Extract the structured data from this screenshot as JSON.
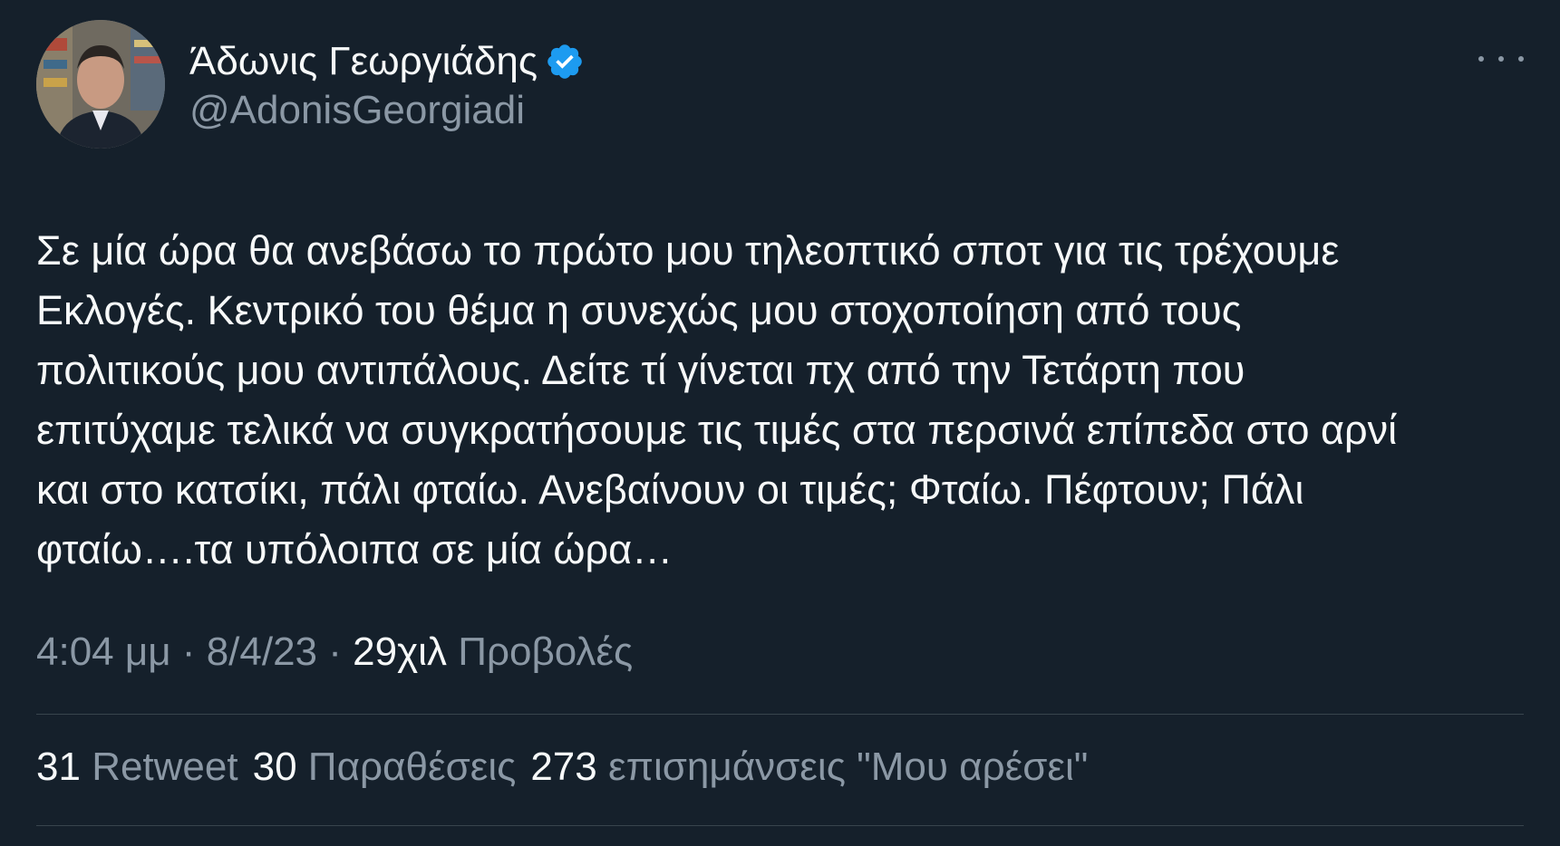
{
  "author": {
    "display_name": "Άδωνις Γεωργιάδης",
    "handle": "@AdonisGeorgiadi",
    "verified_icon": "verified-badge-icon",
    "avatar_icon": "profile-photo"
  },
  "menu": {
    "more_icon": "more-horizontal-icon"
  },
  "tweet": {
    "text": "Σε μία ώρα θα ανεβάσω το πρώτο μου τηλεοπτικό σποτ για τις τρέχουμε\nΕκλογές. Κεντρικό του θέμα η συνεχώς μου στοχοποίηση από τους\nπολιτικούς μου αντιπάλους. Δείτε τί γίνεται πχ από την Τετάρτη που\nεπιτύχαμε τελικά να συγκρατήσουμε τις τιμές στα περσινά επίπεδα στο αρνί\nκαι στο κατσίκι, πάλι φταίω. Ανεβαίνουν οι τιμές; Φταίω. Πέφτουν; Πάλι\nφταίω….τα υπόλοιπα σε μία ώρα…"
  },
  "meta": {
    "time": "4:04 μμ",
    "date": "8/4/23",
    "separator": " · ",
    "views_count": "29χιλ",
    "views_label": "Προβολές"
  },
  "stats": {
    "retweets_count": "31",
    "retweets_label": "Retweet",
    "quotes_count": "30",
    "quotes_label": "Παραθέσεις",
    "likes_count": "273",
    "likes_label": "επισημάνσεις \"Μου αρέσει\""
  },
  "colors": {
    "background": "#15202b",
    "text_primary": "#f7f9f9",
    "text_secondary": "#8b98a5",
    "divider": "#38444d",
    "verified": "#1d9bf0"
  }
}
